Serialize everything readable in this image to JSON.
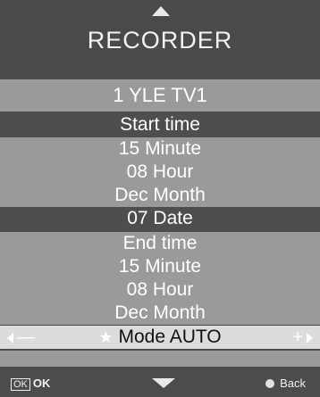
{
  "header": {
    "title": "RECORDER"
  },
  "channel": {
    "label": "1 YLE TV1"
  },
  "start": {
    "heading": "Start time",
    "minute": "15 Minute",
    "hour": "08 Hour",
    "month": "Dec Month",
    "date": "07 Date"
  },
  "end": {
    "heading": "End time",
    "minute": "15 Minute",
    "hour": "08 Hour",
    "month": "Dec Month"
  },
  "mode": {
    "label": "Mode AUTO",
    "decrease": "—",
    "increase": "+",
    "star": "★"
  },
  "footer": {
    "ok_box": "OK",
    "ok_label": "OK",
    "back_label": "Back"
  },
  "colors": {
    "background": "#4c4c4c",
    "light_row": "#9a9a9a",
    "selected_row": "#dcdcdc"
  },
  "icons": [
    "up-arrow-icon",
    "down-arrow-icon",
    "star-icon",
    "left-arrow-icon",
    "right-arrow-icon",
    "back-dot-icon"
  ]
}
